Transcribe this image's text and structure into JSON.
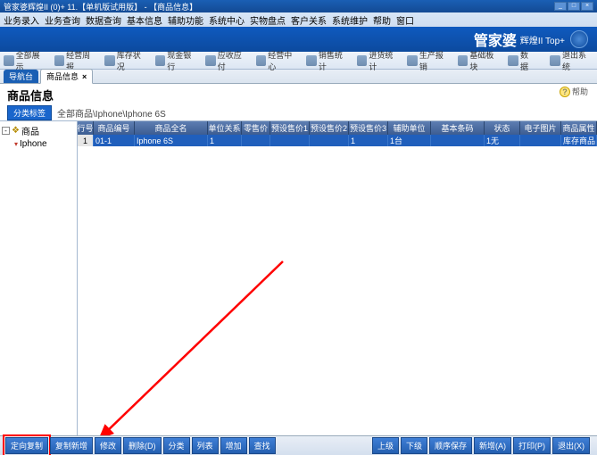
{
  "window": {
    "title": "管家婆辉煌II (0)+ 11.【单机版试用版】 - 【商品信息】"
  },
  "menubar": [
    "业务录入",
    "业务查询",
    "数据查询",
    "基本信息",
    "辅助功能",
    "系统中心",
    "实物盘点",
    "客户关系",
    "系统维护",
    "帮助",
    "窗口"
  ],
  "brand": {
    "main": "管家婆",
    "sub": "辉煌II Top+"
  },
  "toolbar": [
    {
      "label": "全部展示"
    },
    {
      "label": "经营周报"
    },
    {
      "label": "库存状况"
    },
    {
      "label": "现金银行"
    },
    {
      "label": "应收应付"
    },
    {
      "label": "经营中心"
    },
    {
      "label": "销售统计"
    },
    {
      "label": "进货统计"
    },
    {
      "label": "生产报销"
    },
    {
      "label": "基础板块"
    },
    {
      "label": "数据"
    },
    {
      "label": "退出系统"
    }
  ],
  "tabs": [
    {
      "label": "导航台",
      "active": false
    },
    {
      "label": "商品信息",
      "active": true
    }
  ],
  "page": {
    "title": "商品信息",
    "crumb_btn": "分类标签",
    "breadcrumb": "全部商品\\Iphone\\Iphone 6S",
    "help": "帮助"
  },
  "tree": {
    "root": "商品",
    "child": "Iphone"
  },
  "grid": {
    "headers": [
      "行号",
      "商品编号",
      "商品全名",
      "单位关系",
      "零售价",
      "预设售价1",
      "预设售价2",
      "预设售价3",
      "辅助单位",
      "基本条码",
      "状态",
      "电子图片",
      "商品属性"
    ],
    "row": {
      "idx": "1",
      "code": "01-1",
      "name": "Iphone 6S",
      "unit": "1",
      "retail": "",
      "p1": "",
      "p2": "",
      "p3": "1",
      "aux": "1台",
      "barcode": "",
      "status": "1无",
      "img": "",
      "attr": "库存商品"
    }
  },
  "bottom_left": [
    "定向复制",
    "复制新增",
    "修改",
    "删除(D)",
    "分类",
    "列表",
    "增加",
    "查找"
  ],
  "bottom_right": [
    "上级",
    "下级",
    "顺序保存",
    "新增(A)",
    "打印(P)",
    "退出(X)"
  ]
}
